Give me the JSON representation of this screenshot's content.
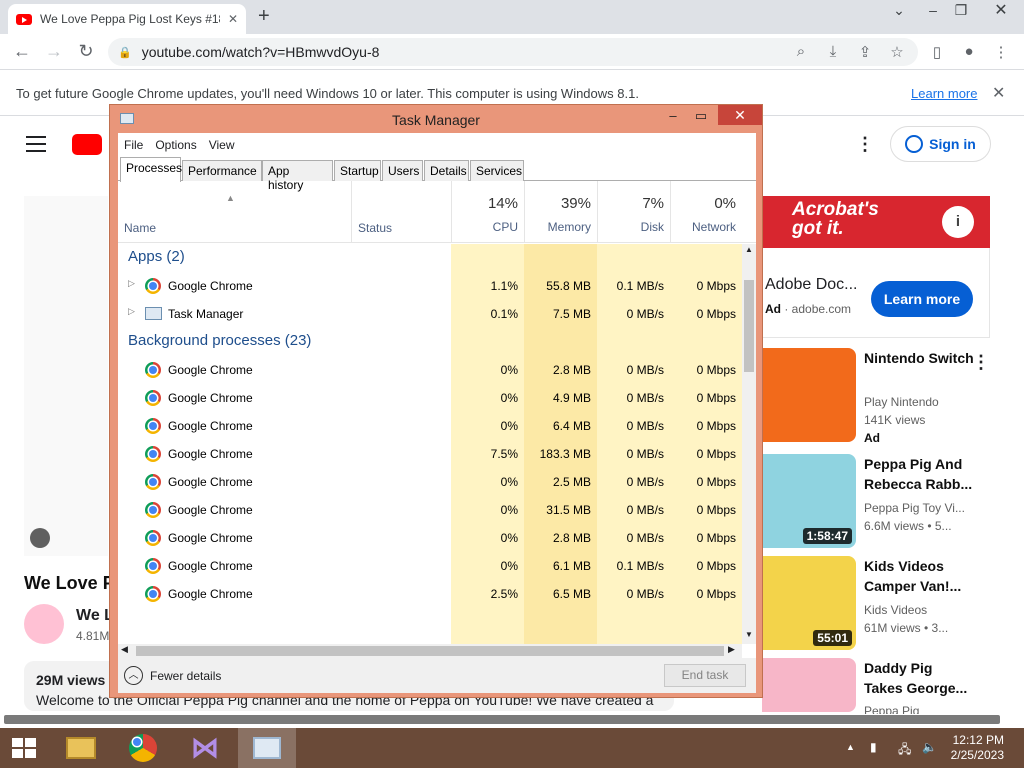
{
  "browser": {
    "tab_title": "We Love Peppa Pig Lost Keys #18",
    "tab_close": "✕",
    "new_tab": "+",
    "url": "youtube.com/watch?v=HBmwvdOyu-8",
    "info_message": "To get future Google Chrome updates, you'll need Windows 10 or later. This computer is using Windows 8.1.",
    "info_learn_more": "Learn more",
    "info_close": "✕"
  },
  "youtube": {
    "video_title": "We Love P",
    "channel_name": "We L",
    "channel_subs": "4.81M",
    "views": "29M views",
    "description": "Welcome to the Official Peppa Pig channel and the home of Peppa on YouTube! We have created a",
    "sign_in": "Sign in",
    "ad": {
      "banner": "Acrobat's got it.",
      "title": "Adobe Doc...",
      "label": "Ad",
      "domain": "adobe.com",
      "cta": "Learn more"
    },
    "recommendations": [
      {
        "title": "Nintendo Switch",
        "channel": "Play Nintendo",
        "meta": "141K views",
        "badge": "Ad",
        "duration": ""
      },
      {
        "title": "Peppa Pig And Rebecca Rabb...",
        "channel": "Peppa Pig Toy Vi...",
        "meta": "6.6M views • 5...",
        "badge": "",
        "duration": "1:58:47"
      },
      {
        "title": "Kids Videos Camper Van!...",
        "channel": "Kids Videos",
        "meta": "61M views • 3...",
        "badge": "",
        "duration": "55:01"
      },
      {
        "title": "Daddy Pig Takes George...",
        "channel": "Peppa Pig",
        "meta": "",
        "badge": "",
        "duration": ""
      }
    ]
  },
  "task_manager": {
    "title": "Task Manager",
    "menu": [
      "File",
      "Options",
      "View"
    ],
    "tabs": [
      "Processes",
      "Performance",
      "App history",
      "Startup",
      "Users",
      "Details",
      "Services"
    ],
    "selected_tab": "Processes",
    "columns": {
      "name": "Name",
      "status": "Status",
      "cpu": {
        "label": "CPU",
        "pct": "14%"
      },
      "memory": {
        "label": "Memory",
        "pct": "39%"
      },
      "disk": {
        "label": "Disk",
        "pct": "7%"
      },
      "network": {
        "label": "Network",
        "pct": "0%"
      }
    },
    "groups": {
      "apps": "Apps (2)",
      "background": "Background processes (23)"
    },
    "apps": [
      {
        "name": "Google Chrome",
        "cpu": "1.1%",
        "memory": "55.8 MB",
        "disk": "0.1 MB/s",
        "network": "0 Mbps",
        "icon": "chrome-icon"
      },
      {
        "name": "Task Manager",
        "cpu": "0.1%",
        "memory": "7.5 MB",
        "disk": "0 MB/s",
        "network": "0 Mbps",
        "icon": "task-manager-icon"
      }
    ],
    "background": [
      {
        "name": "Google Chrome",
        "cpu": "0%",
        "memory": "2.8 MB",
        "disk": "0 MB/s",
        "network": "0 Mbps"
      },
      {
        "name": "Google Chrome",
        "cpu": "0%",
        "memory": "4.9 MB",
        "disk": "0 MB/s",
        "network": "0 Mbps"
      },
      {
        "name": "Google Chrome",
        "cpu": "0%",
        "memory": "6.4 MB",
        "disk": "0 MB/s",
        "network": "0 Mbps"
      },
      {
        "name": "Google Chrome",
        "cpu": "7.5%",
        "memory": "183.3 MB",
        "disk": "0 MB/s",
        "network": "0 Mbps"
      },
      {
        "name": "Google Chrome",
        "cpu": "0%",
        "memory": "2.5 MB",
        "disk": "0 MB/s",
        "network": "0 Mbps"
      },
      {
        "name": "Google Chrome",
        "cpu": "0%",
        "memory": "31.5 MB",
        "disk": "0 MB/s",
        "network": "0 Mbps"
      },
      {
        "name": "Google Chrome",
        "cpu": "0%",
        "memory": "2.8 MB",
        "disk": "0 MB/s",
        "network": "0 Mbps"
      },
      {
        "name": "Google Chrome",
        "cpu": "0%",
        "memory": "6.1 MB",
        "disk": "0.1 MB/s",
        "network": "0 Mbps"
      },
      {
        "name": "Google Chrome",
        "cpu": "2.5%",
        "memory": "6.5 MB",
        "disk": "0 MB/s",
        "network": "0 Mbps"
      }
    ],
    "fewer_details": "Fewer details",
    "end_task": "End task"
  },
  "taskbar": {
    "time": "12:12 PM",
    "date": "2/25/2023",
    "apps": [
      "file-explorer-icon",
      "chrome-icon",
      "visual-studio-icon",
      "task-manager-icon"
    ],
    "active_app": "task-manager-icon"
  },
  "colors": {
    "titlebar": "#e9967a",
    "close_button": "#c7453a",
    "taskbar": "#6a4a38",
    "heat_light": "#fff4c4",
    "heat_medium": "#fce9a6"
  }
}
